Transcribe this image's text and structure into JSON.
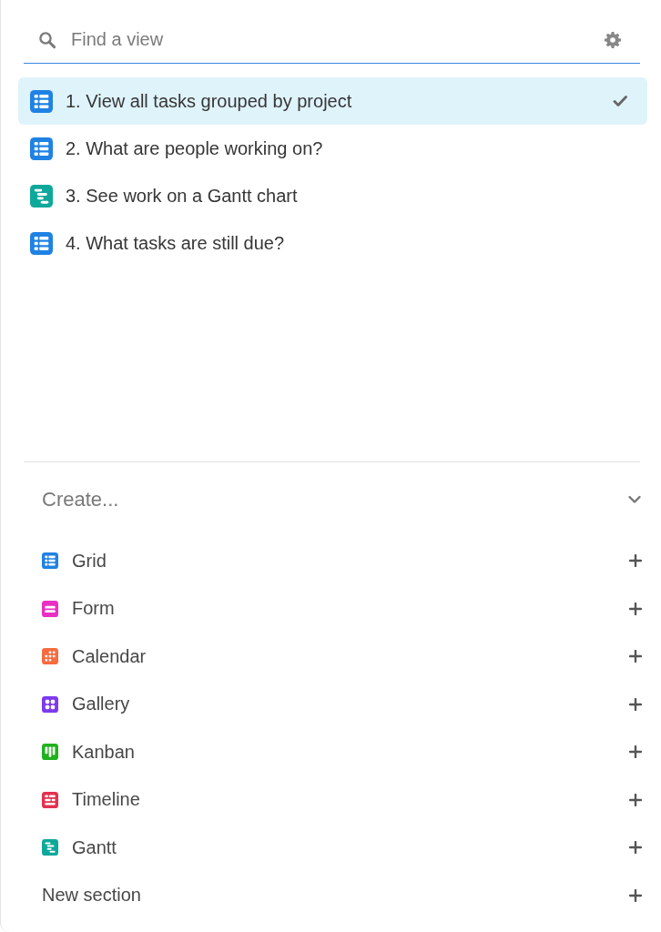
{
  "search": {
    "placeholder": "Find a view"
  },
  "views": [
    {
      "label": "1. View all tasks grouped by project",
      "kind": "grid",
      "color": "#1f82e3",
      "selected": true
    },
    {
      "label": "2. What are people working on?",
      "kind": "grid",
      "color": "#1f82e3",
      "selected": false
    },
    {
      "label": "3. See work on a Gantt chart",
      "kind": "gantt",
      "color": "#0ea89b",
      "selected": false
    },
    {
      "label": "4. What tasks are still due?",
      "kind": "grid",
      "color": "#1f82e3",
      "selected": false
    }
  ],
  "create": {
    "title": "Create...",
    "expanded": true,
    "items": [
      {
        "label": "Grid",
        "kind": "grid",
        "color": "#1f82e3"
      },
      {
        "label": "Form",
        "kind": "form",
        "color": "#e92fc4"
      },
      {
        "label": "Calendar",
        "kind": "calendar",
        "color": "#f76b3f"
      },
      {
        "label": "Gallery",
        "kind": "gallery",
        "color": "#7c3aed"
      },
      {
        "label": "Kanban",
        "kind": "kanban",
        "color": "#20b11d"
      },
      {
        "label": "Timeline",
        "kind": "timeline",
        "color": "#e3314f"
      },
      {
        "label": "Gantt",
        "kind": "gantt",
        "color": "#0ea89b"
      },
      {
        "label": "New section",
        "kind": "section"
      }
    ]
  }
}
